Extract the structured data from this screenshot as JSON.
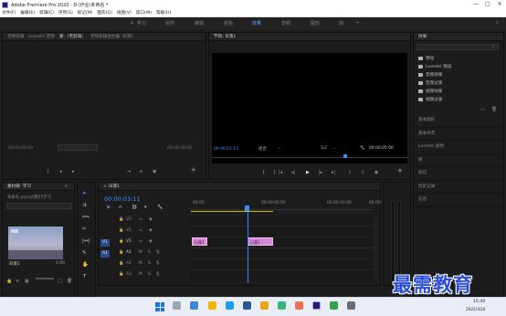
{
  "titlebar": {
    "title": "Adobe Premiere Pro 2020 - D:\\作业\\未命名 *",
    "minimize": "—",
    "maximize": "□",
    "close": "✕"
  },
  "menu": [
    "文件(F)",
    "编辑(E)",
    "剪辑(C)",
    "序列(S)",
    "标记(M)",
    "图形(G)",
    "视图(V)",
    "窗口(W)",
    "帮助(H)"
  ],
  "workspaces": [
    "学习",
    "组件",
    "编辑",
    "颜色",
    "效果",
    "音频",
    "图形",
    "库"
  ],
  "source_panel": {
    "tabs": [
      "音频剪辑",
      "Lumetri 范围",
      "源:（无剪辑）",
      "音频剪辑混合器: 日落1"
    ],
    "timecode": "00;00;00;00",
    "right_timecode": "00;00;00;00"
  },
  "program_panel": {
    "tab": "节目: 日落1",
    "timecode": "00:00:03:11",
    "fit_label": "适合",
    "zoom": "1/2",
    "duration": "00:00:05:00"
  },
  "effects_panel": {
    "title": "效果",
    "tree": [
      "预设",
      "Lumetri 预设",
      "音频效果",
      "音频过渡",
      "视频效果",
      "视频过渡"
    ],
    "sections": [
      "基本图形",
      "基本声音",
      "Lumetri 颜色",
      "库",
      "标记",
      "历史记录",
      "信息"
    ]
  },
  "project_panel": {
    "tab": "素材箱: 学习",
    "path": "未命名.prproj\\我们\\学习",
    "clip_name": "日落1",
    "clip_duration": "5:00"
  },
  "timeline": {
    "tab": "日落1",
    "timecode": "00:00:03:11",
    "ruler": [
      "00:00",
      "00:00:05:00",
      "00:00:10:00",
      "00:00:15:00"
    ],
    "video_tracks": [
      "V3",
      "V2",
      "V1"
    ],
    "audio_tracks": [
      "A1",
      "A2",
      "A3"
    ],
    "source_patch_video": "V1",
    "source_patch_audio": "A1",
    "clips": [
      "日落1",
      "日落1"
    ]
  },
  "taskbar": {
    "time": "15:40",
    "date": "2022/3/24",
    "watermark": "最需教育"
  }
}
